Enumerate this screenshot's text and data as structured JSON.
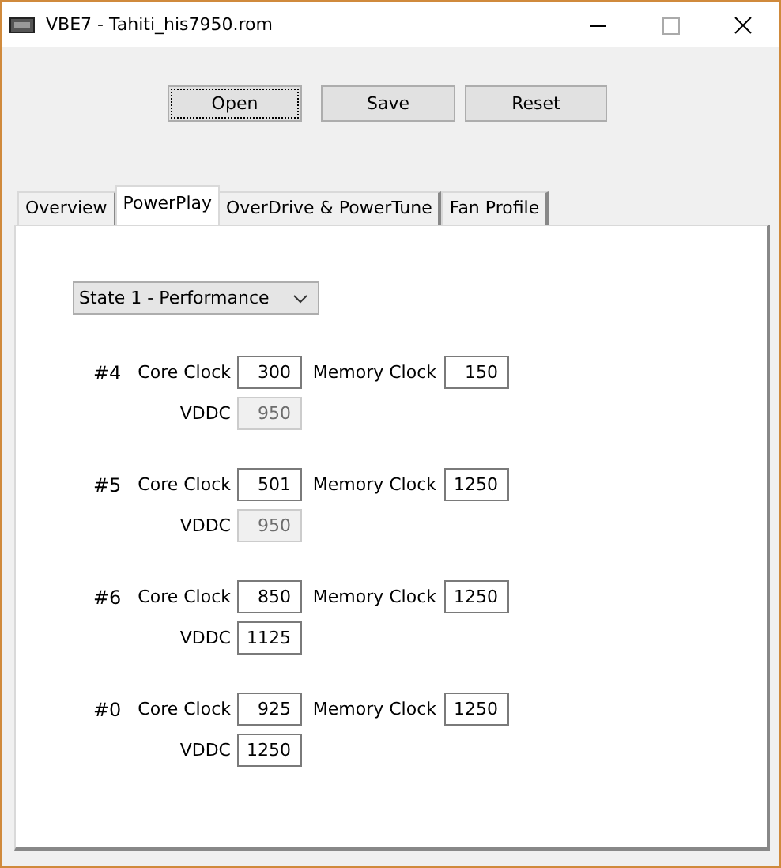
{
  "window": {
    "title": "VBE7 - Tahiti_his7950.rom"
  },
  "buttons": [
    {
      "label": "Open",
      "focused": true
    },
    {
      "label": "Save",
      "focused": false
    },
    {
      "label": "Reset",
      "focused": false
    }
  ],
  "tabs": [
    {
      "label": "Overview",
      "selected": false
    },
    {
      "label": "PowerPlay",
      "selected": true
    },
    {
      "label": "OverDrive & PowerTune",
      "selected": false
    },
    {
      "label": "Fan Profile",
      "selected": false
    }
  ],
  "state_select": {
    "value": "State 1 - Performance"
  },
  "states": [
    {
      "index": "#4",
      "core_label": "Core Clock",
      "core": "300",
      "memory_label": "Memory Clock",
      "memory": "150",
      "vddc_label": "VDDC",
      "vddc": "950",
      "vddc_disabled": true
    },
    {
      "index": "#5",
      "core_label": "Core Clock",
      "core": "501",
      "memory_label": "Memory Clock",
      "memory": "1250",
      "vddc_label": "VDDC",
      "vddc": "950",
      "vddc_disabled": true
    },
    {
      "index": "#6",
      "core_label": "Core Clock",
      "core": "850",
      "memory_label": "Memory Clock",
      "memory": "1250",
      "vddc_label": "VDDC",
      "vddc": "1125",
      "vddc_disabled": false
    },
    {
      "index": "#0",
      "core_label": "Core Clock",
      "core": "925",
      "memory_label": "Memory Clock",
      "memory": "1250",
      "vddc_label": "VDDC",
      "vddc": "1250",
      "vddc_disabled": false
    }
  ]
}
